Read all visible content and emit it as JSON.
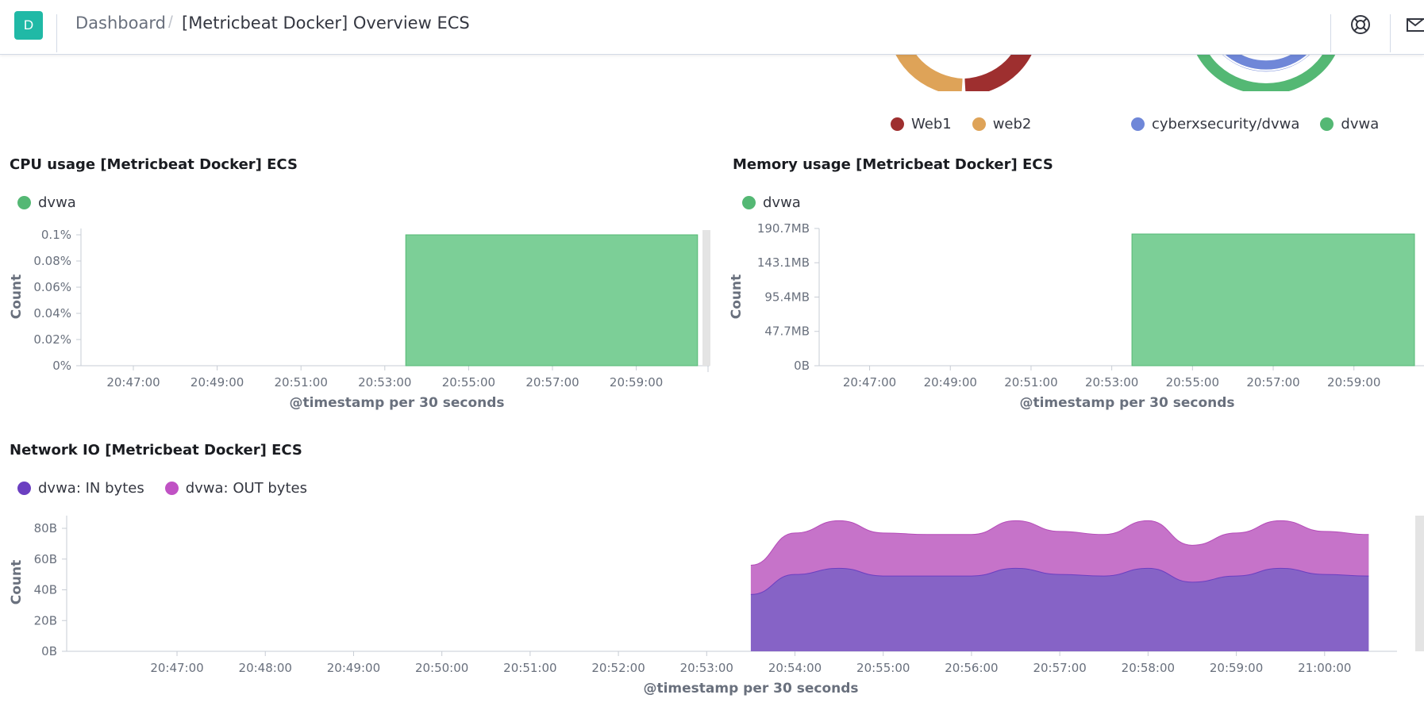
{
  "header": {
    "avatar_letter": "D",
    "breadcrumb_root": "Dashboard",
    "breadcrumb_current": "[Metricbeat Docker] Overview ECS",
    "icons": [
      "help-icon",
      "mail-icon"
    ]
  },
  "top_legends": {
    "left": [
      {
        "label": "Web1",
        "color": "#9e2f2f"
      },
      {
        "label": "web2",
        "color": "#dea358"
      }
    ],
    "right": [
      {
        "label": "cyberxsecurity/dvwa",
        "color": "#6f87d8"
      },
      {
        "label": "dvwa",
        "color": "#54b874"
      }
    ]
  },
  "cpu_panel": {
    "title": "CPU usage [Metricbeat Docker] ECS",
    "legend": [
      {
        "label": "dvwa",
        "color": "#54b874"
      }
    ],
    "ylabel": "Count",
    "xlabel": "@timestamp per 30 seconds",
    "y_ticks": [
      "0%",
      "0.02%",
      "0.04%",
      "0.06%",
      "0.08%",
      "0.1%"
    ],
    "x_ticks": [
      "20:47:00",
      "20:49:00",
      "20:51:00",
      "20:53:00",
      "20:55:00",
      "20:57:00",
      "20:59:00"
    ]
  },
  "memory_panel": {
    "title": "Memory usage [Metricbeat Docker] ECS",
    "legend": [
      {
        "label": "dvwa",
        "color": "#54b874"
      }
    ],
    "ylabel": "Count",
    "xlabel": "@timestamp per 30 seconds",
    "y_ticks": [
      "0B",
      "47.7MB",
      "95.4MB",
      "143.1MB",
      "190.7MB"
    ],
    "x_ticks": [
      "20:47:00",
      "20:49:00",
      "20:51:00",
      "20:53:00",
      "20:55:00",
      "20:57:00",
      "20:59:00"
    ]
  },
  "network_panel": {
    "title": "Network IO [Metricbeat Docker] ECS",
    "legend": [
      {
        "label": "dvwa: IN bytes",
        "color": "#6b3fc1"
      },
      {
        "label": "dvwa: OUT bytes",
        "color": "#c052c4"
      }
    ],
    "ylabel": "Count",
    "xlabel": "@timestamp per 30 seconds",
    "y_ticks": [
      "0B",
      "20B",
      "40B",
      "60B",
      "80B"
    ],
    "x_ticks": [
      "20:47:00",
      "20:48:00",
      "20:49:00",
      "20:50:00",
      "20:51:00",
      "20:52:00",
      "20:53:00",
      "20:54:00",
      "20:55:00",
      "20:56:00",
      "20:57:00",
      "20:58:00",
      "20:59:00",
      "21:00:00"
    ]
  },
  "chart_data": [
    {
      "type": "bar",
      "title": "CPU usage [Metricbeat Docker] ECS",
      "xlabel": "@timestamp per 30 seconds",
      "ylabel": "Count",
      "ylim": [
        0,
        0.1
      ],
      "series": [
        {
          "name": "dvwa",
          "bars": [
            {
              "start": "20:53:30",
              "end": "21:00:30",
              "value": 0.1
            }
          ]
        }
      ]
    },
    {
      "type": "bar",
      "title": "Memory usage [Metricbeat Docker] ECS",
      "xlabel": "@timestamp per 30 seconds",
      "ylabel": "Count",
      "ylim_mb": [
        0,
        190.7
      ],
      "series": [
        {
          "name": "dvwa",
          "bars": [
            {
              "start": "20:53:30",
              "end": "21:00:30",
              "value_mb": 183
            }
          ]
        }
      ]
    },
    {
      "type": "area",
      "title": "Network IO [Metricbeat Docker] ECS",
      "xlabel": "@timestamp per 30 seconds",
      "ylabel": "Count",
      "ylim": [
        0,
        80
      ],
      "x": [
        "20:53:30",
        "20:54:00",
        "20:54:30",
        "20:55:00",
        "20:55:30",
        "20:56:00",
        "20:56:30",
        "20:57:00",
        "20:57:30",
        "20:58:00",
        "20:58:30",
        "20:59:00",
        "20:59:30",
        "21:00:00",
        "21:00:30"
      ],
      "series": [
        {
          "name": "dvwa: IN bytes",
          "values": [
            37,
            50,
            54,
            49,
            49,
            49,
            54,
            50,
            49,
            54,
            45,
            49,
            54,
            50,
            49
          ]
        },
        {
          "name": "dvwa: OUT bytes",
          "values": [
            19,
            27,
            31,
            28,
            27,
            27,
            31,
            28,
            27,
            31,
            24,
            28,
            31,
            28,
            27
          ]
        }
      ]
    }
  ]
}
